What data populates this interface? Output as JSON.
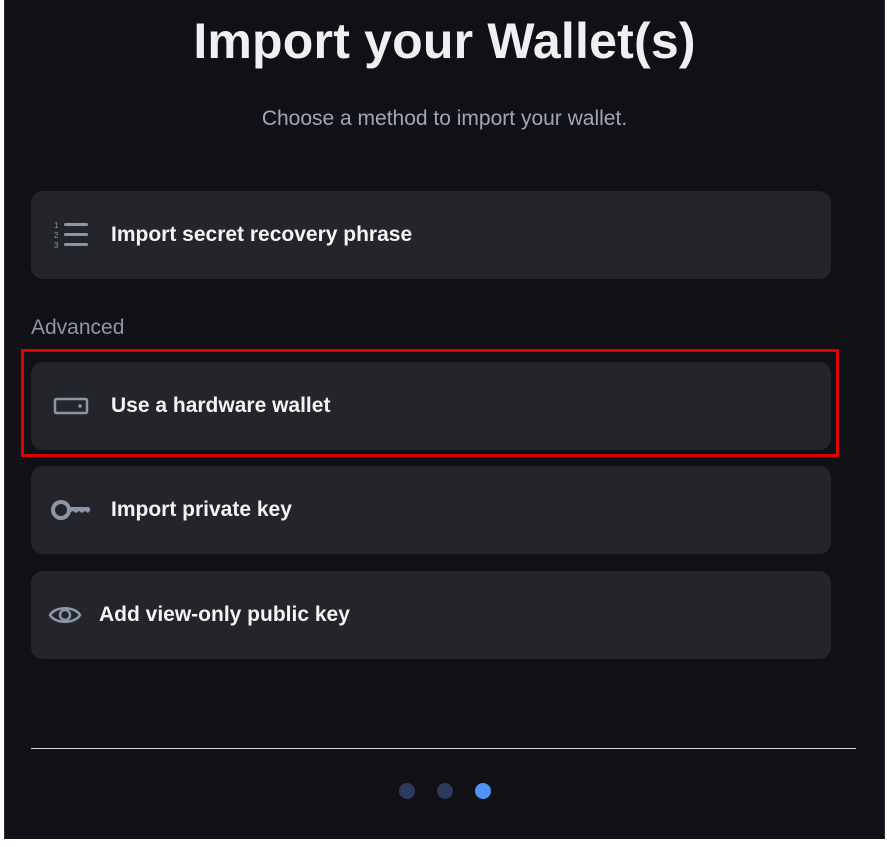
{
  "header": {
    "title": "Import your Wallet(s)",
    "subtitle": "Choose a method to import your wallet."
  },
  "options": {
    "primary": {
      "label": "Import secret recovery phrase",
      "icon": "numbered-list-icon"
    },
    "section_label": "Advanced",
    "advanced": [
      {
        "label": "Use a hardware wallet",
        "icon": "hardware-wallet-icon",
        "highlighted": true
      },
      {
        "label": "Import private key",
        "icon": "key-icon"
      },
      {
        "label": "Add view-only public key",
        "icon": "eye-icon"
      }
    ]
  },
  "pagination": {
    "total_steps": 3,
    "current_step": 3
  },
  "colors": {
    "background": "#0f1116",
    "card": "#23252b",
    "highlight_border": "#e00000",
    "dot_active": "#4f93f5",
    "dot_inactive": "#2b3a5d"
  }
}
